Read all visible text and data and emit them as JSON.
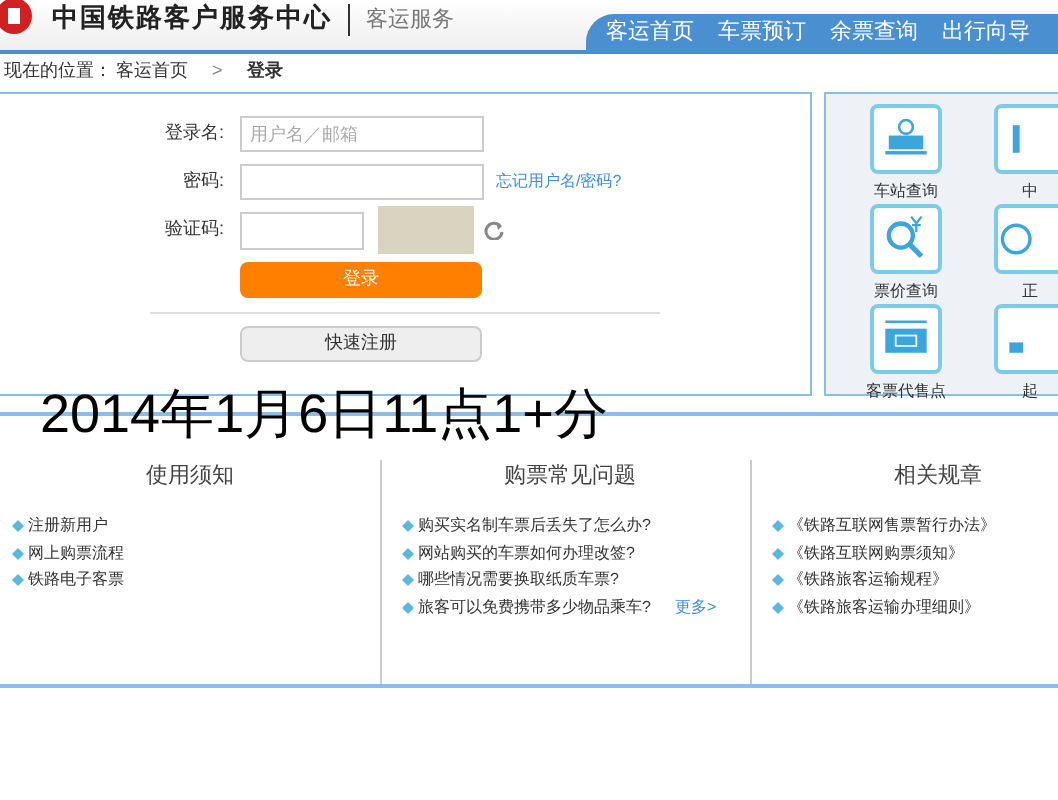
{
  "header": {
    "site_title": "中国铁路客户服务中心",
    "section": "客运服务"
  },
  "nav": [
    {
      "label": "客运首页"
    },
    {
      "label": "车票预订"
    },
    {
      "label": "余票查询"
    },
    {
      "label": "出行向导"
    }
  ],
  "breadcrumb": {
    "prefix": "现在的位置：",
    "home": "客运首页",
    "separator": ">",
    "current": "登录"
  },
  "login": {
    "fields": [
      {
        "kind": "text",
        "label": "登录名:",
        "placeholder": "用户名／邮箱"
      },
      {
        "kind": "password",
        "label": "密码:",
        "link": "忘记用户名/密码?"
      },
      {
        "kind": "captcha",
        "label": "验证码:"
      }
    ],
    "submit": "登录",
    "register": "快速注册"
  },
  "services": [
    {
      "label": "车站查询"
    },
    {
      "label": "中"
    },
    {
      "label": "票价查询"
    },
    {
      "label": "正"
    },
    {
      "label": "客票代售点"
    },
    {
      "label": "起"
    }
  ],
  "overlay_text": "2014年1月6日11点1+分",
  "columns": [
    {
      "title": "使用须知",
      "items": [
        "注册新用户",
        "网上购票流程",
        "铁路电子客票"
      ]
    },
    {
      "title": "购票常见问题",
      "items": [
        "购买实名制车票后丢失了怎么办?",
        "网站购买的车票如何办理改签?",
        "哪些情况需要换取纸质车票?",
        "旅客可以免费携带多少物品乘车?"
      ],
      "more": "更多>"
    },
    {
      "title": "相关规章",
      "items": [
        "《铁路互联网售票暂行办法》",
        "《铁路互联网购票须知》",
        "《铁路旅客运输规程》",
        "《铁路旅客运输办理细则》"
      ]
    }
  ]
}
